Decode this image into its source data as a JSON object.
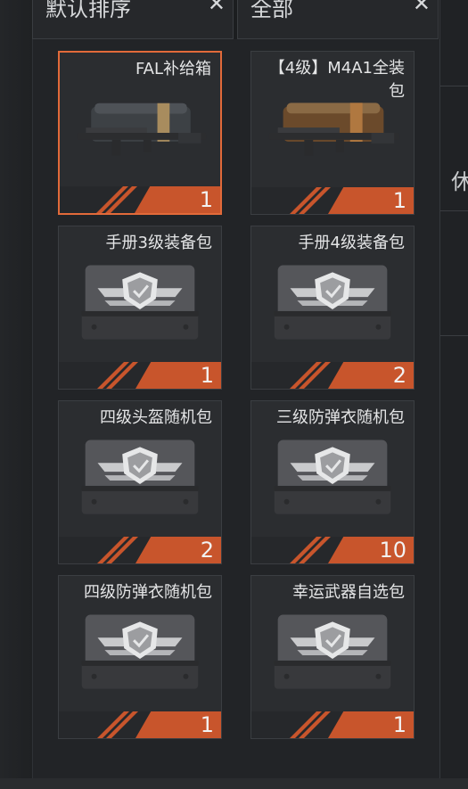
{
  "filters": {
    "sort": {
      "label": "默认排序",
      "icon": "close-icon"
    },
    "category": {
      "label": "全部",
      "icon": "close-icon"
    }
  },
  "right_panel": {
    "label": "休"
  },
  "items": [
    {
      "name": "FAL补给箱",
      "qty": "1",
      "type": "weapon-crate"
    },
    {
      "name": "【4级】M4A1全装包",
      "qty": "1",
      "type": "weapon-crate"
    },
    {
      "name": "手册3级装备包",
      "qty": "1",
      "type": "gear-crate"
    },
    {
      "name": "手册4级装备包",
      "qty": "2",
      "type": "gear-crate"
    },
    {
      "name": "四级头盔随机包",
      "qty": "2",
      "type": "gear-crate"
    },
    {
      "name": "三级防弹衣随机包",
      "qty": "10",
      "type": "gear-crate"
    },
    {
      "name": "四级防弹衣随机包",
      "qty": "1",
      "type": "gear-crate"
    },
    {
      "name": "幸运武器自选包",
      "qty": "1",
      "type": "gear-crate"
    }
  ],
  "colors": {
    "accent": "#e26a3a",
    "qty_tab": "#c8552c",
    "panel": "#222427"
  }
}
